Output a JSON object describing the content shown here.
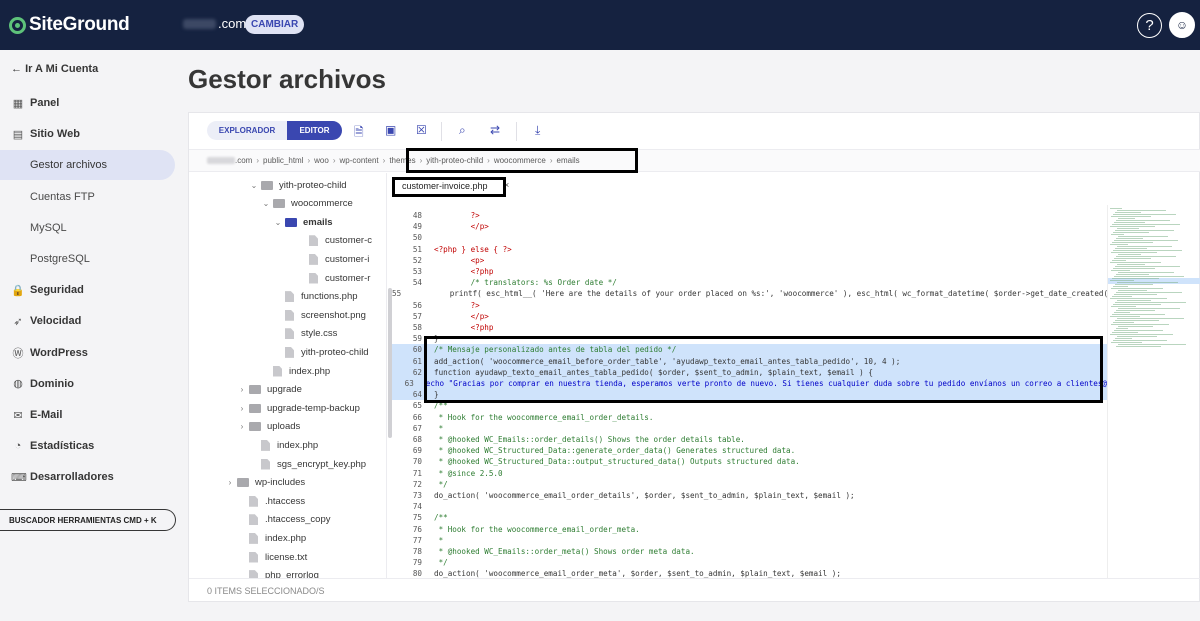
{
  "topbar": {
    "brand": "SiteGround",
    "domain_suffix": ".com",
    "change_label": "CAMBIAR",
    "help_label": "?"
  },
  "sidebar": {
    "back_label": "Ir A Mi Cuenta",
    "items": [
      {
        "label": "Panel",
        "icon": "grid-icon"
      },
      {
        "label": "Sitio Web",
        "icon": "website-icon"
      },
      {
        "label": "Gestor archivos",
        "sub": true,
        "active": true
      },
      {
        "label": "Cuentas FTP",
        "sub": true
      },
      {
        "label": "MySQL",
        "sub": true
      },
      {
        "label": "PostgreSQL",
        "sub": true
      },
      {
        "label": "Seguridad",
        "icon": "lock-icon"
      },
      {
        "label": "Velocidad",
        "icon": "rocket-icon"
      },
      {
        "label": "WordPress",
        "icon": "wordpress-icon"
      },
      {
        "label": "Dominio",
        "icon": "globe-icon"
      },
      {
        "label": "E-Mail",
        "icon": "mail-icon"
      },
      {
        "label": "Estadísticas",
        "icon": "stats-icon"
      },
      {
        "label": "Desarrolladores",
        "icon": "code-icon"
      }
    ],
    "tools_search": "BUSCADOR HERRAMIENTAS CMD + K"
  },
  "page": {
    "title": "Gestor archivos"
  },
  "toolbar": {
    "explorer": "EXPLORADOR",
    "editor": "EDITOR"
  },
  "breadcrumb": [
    ".com",
    "public_html",
    "woo",
    "wp-content",
    "themes",
    "yith-proteo-child",
    "woocommerce",
    "emails"
  ],
  "tree": [
    {
      "label": "yith-proteo-child",
      "type": "folder",
      "indent": 72,
      "caret": "v"
    },
    {
      "label": "woocommerce",
      "type": "folder",
      "indent": 84,
      "caret": "v"
    },
    {
      "label": "emails",
      "type": "folder-open",
      "indent": 96,
      "caret": "v",
      "bold": true
    },
    {
      "label": "customer-c",
      "type": "file",
      "indent": 120
    },
    {
      "label": "customer-i",
      "type": "file",
      "indent": 120
    },
    {
      "label": "customer-r",
      "type": "file",
      "indent": 120
    },
    {
      "label": "functions.php",
      "type": "file",
      "indent": 96
    },
    {
      "label": "screenshot.png",
      "type": "file",
      "indent": 96
    },
    {
      "label": "style.css",
      "type": "file",
      "indent": 96
    },
    {
      "label": "yith-proteo-child",
      "type": "file",
      "indent": 96
    },
    {
      "label": "index.php",
      "type": "file",
      "indent": 84
    },
    {
      "label": "upgrade",
      "type": "folder",
      "indent": 60,
      "caret": ">"
    },
    {
      "label": "upgrade-temp-backup",
      "type": "folder",
      "indent": 60,
      "caret": ">"
    },
    {
      "label": "uploads",
      "type": "folder",
      "indent": 60,
      "caret": ">"
    },
    {
      "label": "index.php",
      "type": "file",
      "indent": 72
    },
    {
      "label": "sgs_encrypt_key.php",
      "type": "file",
      "indent": 72
    },
    {
      "label": "wp-includes",
      "type": "folder",
      "indent": 48,
      "caret": ">"
    },
    {
      "label": ".htaccess",
      "type": "file",
      "indent": 60
    },
    {
      "label": ".htaccess_copy",
      "type": "file",
      "indent": 60
    },
    {
      "label": "index.php",
      "type": "file",
      "indent": 60
    },
    {
      "label": "license.txt",
      "type": "file",
      "indent": 60
    },
    {
      "label": "php_errorlog",
      "type": "file",
      "indent": 60
    }
  ],
  "editor": {
    "file_tab": "customer-invoice.php",
    "close": "×"
  },
  "code": [
    {
      "n": "48",
      "t": "        ?>"
    },
    {
      "n": "49",
      "t": "        </p>"
    },
    {
      "n": "50",
      "t": ""
    },
    {
      "n": "51",
      "t": "<?php } else { ?>"
    },
    {
      "n": "52",
      "t": "        <p>"
    },
    {
      "n": "53",
      "t": "        <?php"
    },
    {
      "n": "54",
      "t": "        /* translators: %s Order date */"
    },
    {
      "n": "55",
      "t": "        printf( esc_html__( 'Here are the details of your order placed on %s:', 'woocommerce' ), esc_html( wc_format_datetime( $order->get_date_created() ) ) );"
    },
    {
      "n": "56",
      "t": "        ?>"
    },
    {
      "n": "57",
      "t": "        </p>"
    },
    {
      "n": "58",
      "t": "        <?php"
    },
    {
      "n": "59",
      "t": "}"
    },
    {
      "n": "60",
      "t": "/* Mensaje personalizado antes de tabla del pedido */",
      "sel": true
    },
    {
      "n": "61",
      "t": "add_action( 'woocommerce_email_before_order_table', 'ayudawp_texto_email_antes_tabla_pedido', 10, 4 );",
      "sel": true
    },
    {
      "n": "62",
      "t": "function ayudawp_texto_email_antes_tabla_pedido( $order, $sent_to_admin, $plain_text, $email ) {",
      "sel": true
    },
    {
      "n": "63",
      "t": "echo \"Gracias por comprar en nuestra tienda, esperamos verte pronto de nuevo. Si tienes cualquier duda sobre tu pedido envíanos un correo a clientes@",
      "sel": true
    },
    {
      "n": "64",
      "t": "}",
      "sel": true
    },
    {
      "n": "65",
      "t": "/**"
    },
    {
      "n": "66",
      "t": " * Hook for the woocommerce_email_order_details."
    },
    {
      "n": "67",
      "t": " *"
    },
    {
      "n": "68",
      "t": " * @hooked WC_Emails::order_details() Shows the order details table."
    },
    {
      "n": "69",
      "t": " * @hooked WC_Structured_Data::generate_order_data() Generates structured data."
    },
    {
      "n": "70",
      "t": " * @hooked WC_Structured_Data::output_structured_data() Outputs structured data."
    },
    {
      "n": "71",
      "t": " * @since 2.5.0"
    },
    {
      "n": "72",
      "t": " */"
    },
    {
      "n": "73",
      "t": "do_action( 'woocommerce_email_order_details', $order, $sent_to_admin, $plain_text, $email );"
    },
    {
      "n": "74",
      "t": ""
    },
    {
      "n": "75",
      "t": "/**"
    },
    {
      "n": "76",
      "t": " * Hook for the woocommerce_email_order_meta."
    },
    {
      "n": "77",
      "t": " *"
    },
    {
      "n": "78",
      "t": " * @hooked WC_Emails::order_meta() Shows order meta data."
    },
    {
      "n": "79",
      "t": " */"
    },
    {
      "n": "80",
      "t": "do_action( 'woocommerce_email_order_meta', $order, $sent_to_admin, $plain_text, $email );"
    }
  ],
  "status": "0 ITEMS SELECCIONADO/S"
}
